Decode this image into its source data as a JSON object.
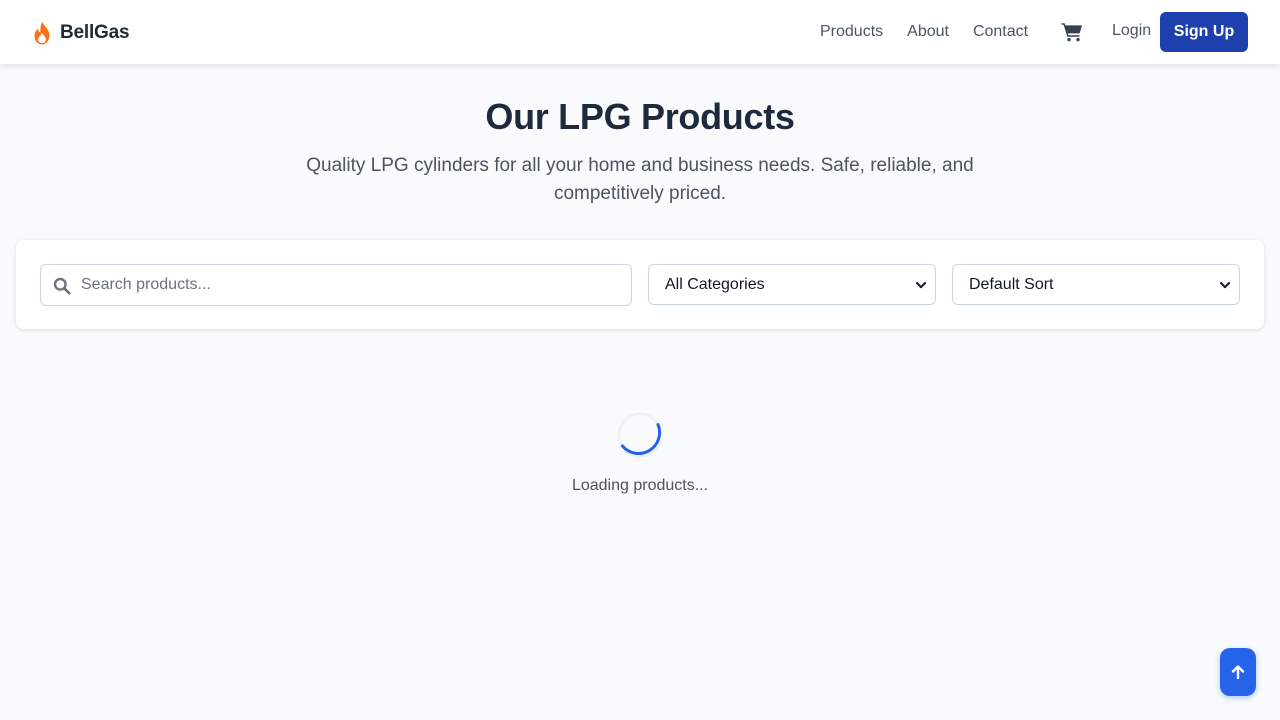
{
  "header": {
    "brand": "BellGas",
    "nav": [
      {
        "label": "Products"
      },
      {
        "label": "About"
      },
      {
        "label": "Contact"
      }
    ],
    "cart_icon": "shopping-cart-icon",
    "login_label": "Login",
    "signup_label": "Sign Up"
  },
  "hero": {
    "title": "Our LPG Products",
    "subtitle": "Quality LPG cylinders for all your home and business needs. Safe, reliable, and competitively priced."
  },
  "filters": {
    "search_placeholder": "Search products...",
    "search_value": "",
    "category_selected": "All Categories",
    "sort_selected": "Default Sort"
  },
  "loading": {
    "text": "Loading products..."
  },
  "colors": {
    "brand_flame": "#f97316",
    "primary": "#1e40af",
    "accent": "#2563eb",
    "background": "#f8fafc"
  },
  "icons": {
    "logo": "flame-icon",
    "search": "search-icon",
    "chevron": "chevron-down-icon",
    "scroll_top": "arrow-up-icon"
  }
}
